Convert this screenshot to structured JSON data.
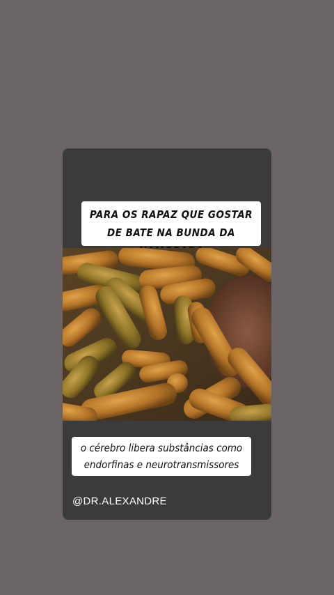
{
  "story": {
    "top_caption": "PARA OS RAPAZ QUE GOSTAR DE BATE NA BUNDA DA NAMORADA",
    "bottom_caption": "o cérebro libera substâncias como endorfinas e neurotransmissores",
    "handle": "@DR.ALEXANDRE",
    "image_description": "photo of brown worm-like bacteria",
    "colors": {
      "page_background": "#6b6467",
      "card_background": "#3c3b3c",
      "caption_background": "#ffffff"
    }
  }
}
